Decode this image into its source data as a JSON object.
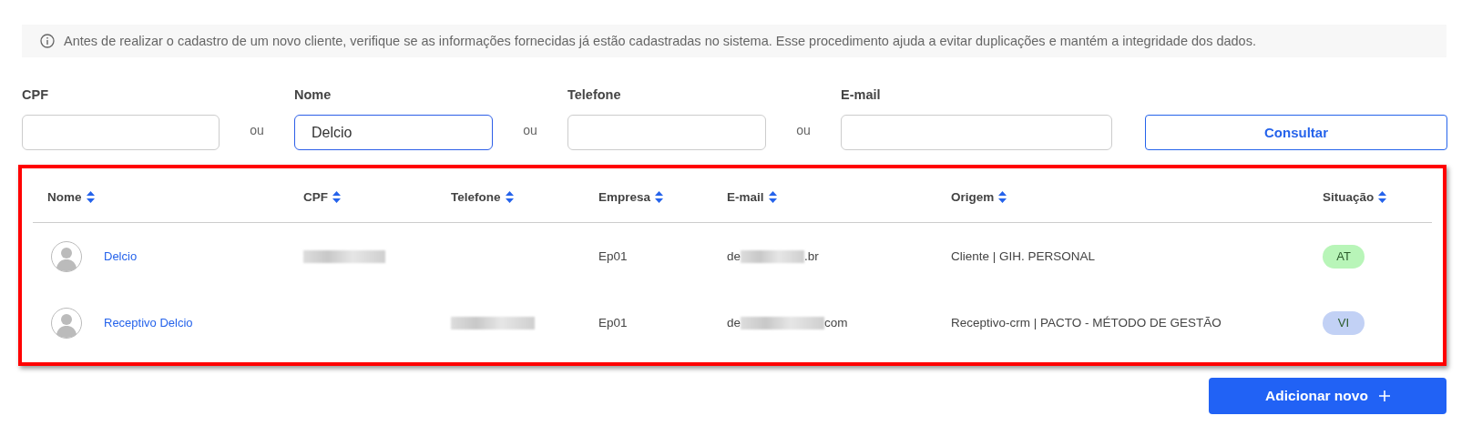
{
  "notice": {
    "text": "Antes de realizar o cadastro de um novo cliente, verifique se as informações fornecidas já estão cadastradas no sistema. Esse procedimento ajuda a evitar duplicações e mantém a integridade dos dados."
  },
  "filters": [
    {
      "label": "CPF",
      "focused": false
    },
    {
      "label": "Nome",
      "value": "Delcio",
      "focused": true
    },
    {
      "label": "Telefone",
      "focused": false
    },
    {
      "label": "E-mail",
      "focused": false
    }
  ],
  "separators": [
    "ou",
    "ou",
    "ou"
  ],
  "search_button": "Consultar",
  "table": {
    "highlighted": true,
    "columns": [
      "Nome",
      "CPF",
      "Telefone",
      "Empresa",
      "E-mail",
      "Origem",
      "Situação"
    ],
    "rows": [
      {
        "name": "Delcio",
        "cpf_redacted": true,
        "phone_redacted": false,
        "company": "Ep01",
        "email_start": "de",
        "email_end": ".br",
        "origin": "Cliente | GIH. PERSONAL",
        "status": "AT",
        "color": "#b8f5b8"
      },
      {
        "name": "Receptivo Delcio",
        "cpf_redacted": false,
        "phone_redacted": true,
        "company": "Ep01",
        "email_start": "de",
        "email_end": "com",
        "origin": "Receptivo-crm | PACTO - MÉTODO DE GESTÃO",
        "status": "VI",
        "color": "#c2d1f5"
      }
    ]
  },
  "add_button": "Adicionar novo"
}
